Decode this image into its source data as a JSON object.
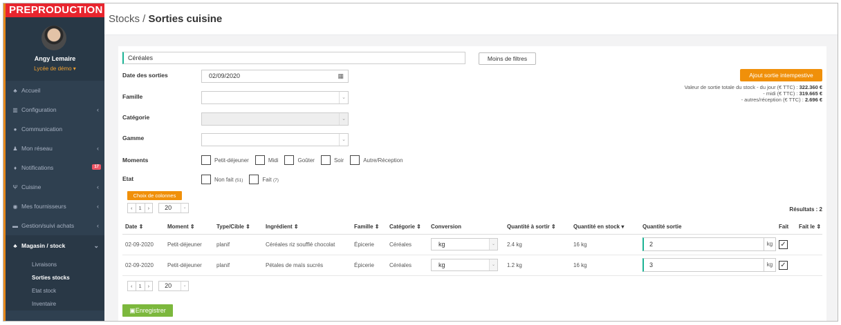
{
  "env_banner": "PREPRODUCTION",
  "user": {
    "name": "Angy Lemaire",
    "school": "Lycée de démo ▾"
  },
  "nav": [
    {
      "label": "Accueil",
      "icon": "home-icon",
      "glyph": "♣",
      "chev": ""
    },
    {
      "label": "Configuration",
      "icon": "institution-icon",
      "glyph": "▥",
      "chev": "‹"
    },
    {
      "label": "Communication",
      "icon": "chat-icon",
      "glyph": "●",
      "chev": ""
    },
    {
      "label": "Mon réseau",
      "icon": "users-icon",
      "glyph": "♟",
      "chev": "‹"
    },
    {
      "label": "Notifications",
      "icon": "bell-icon",
      "glyph": "♦",
      "badge": "17"
    },
    {
      "label": "Cuisine",
      "icon": "cutlery-icon",
      "glyph": "Ψ",
      "chev": "‹"
    },
    {
      "label": "Mes fournisseurs",
      "icon": "eye-icon",
      "glyph": "◉",
      "chev": "‹"
    },
    {
      "label": "Gestion/suivi achats",
      "icon": "cart-icon",
      "glyph": "▬",
      "chev": "‹"
    }
  ],
  "nav_active": {
    "label": "Magasin / stock",
    "icon": "cubes-icon",
    "glyph": "♣",
    "chev": "⌄"
  },
  "subnav": [
    "Livraisons",
    "Sorties stocks",
    "Etat stock",
    "Inventaire"
  ],
  "breadcrumb": {
    "section": "Stocks / ",
    "page": "Sorties cuisine"
  },
  "search_value": "Céréales",
  "filters_button": "Moins de filtres",
  "add_button": "Ajout sortie intempestive",
  "totals": {
    "line1_label": "Valeur de sortie totale du stock - du jour (€ TTC) : ",
    "line1_value": "322.360 €",
    "line2_label": "- midi (€ TTC) : ",
    "line2_value": "319.665 €",
    "line3_label": "- autres/réception (€ TTC) : ",
    "line3_value": "2.696 €"
  },
  "filters": {
    "date_label": "Date des sorties",
    "date_value": "02/09/2020",
    "famille_label": "Famille",
    "categorie_label": "Catégorie",
    "gamme_label": "Gamme",
    "moments_label": "Moments",
    "moments": [
      "Petit-déjeuner",
      "Midi",
      "Goûter",
      "Soir",
      "Autre/Réception"
    ],
    "etat_label": "Etat",
    "etat": [
      {
        "label": "Non fait",
        "count": "(51)"
      },
      {
        "label": "Fait",
        "count": "(7)"
      }
    ]
  },
  "columns_button": "Choix de colonnes",
  "pager": {
    "prev": "‹",
    "page": "1",
    "next": "›",
    "size": "20"
  },
  "results_label": "Résultats : 2",
  "table": {
    "headers": [
      "Date ⇕",
      "Moment ⇕",
      "Type/Cible ⇕",
      "Ingrédient ⇕",
      "Famille ⇕",
      "Catégorie ⇕",
      "Conversion",
      "Quantité à sortir ⇕",
      "Quantité en stock ▾",
      "Quantité sortie",
      "Fait",
      "Fait le ⇕"
    ],
    "rows": [
      {
        "date": "02-09-2020",
        "moment": "Petit-déjeuner",
        "type": "planif",
        "ingredient": "Céréales riz soufflé chocolat",
        "famille": "Épicerie",
        "categorie": "Céréales",
        "conversion": "kg",
        "qty_out": "2.4 kg",
        "qty_stock": "16 kg",
        "qty_done": "2",
        "unit": "kg",
        "fait": "✓"
      },
      {
        "date": "02-09-2020",
        "moment": "Petit-déjeuner",
        "type": "planif",
        "ingredient": "Pétales de maïs sucrés",
        "famille": "Épicerie",
        "categorie": "Céréales",
        "conversion": "kg",
        "qty_out": "1.2 kg",
        "qty_stock": "16 kg",
        "qty_done": "3",
        "unit": "kg",
        "fait": "✓"
      }
    ]
  },
  "save_button": "Enregistrer",
  "save_glyph": "▣"
}
